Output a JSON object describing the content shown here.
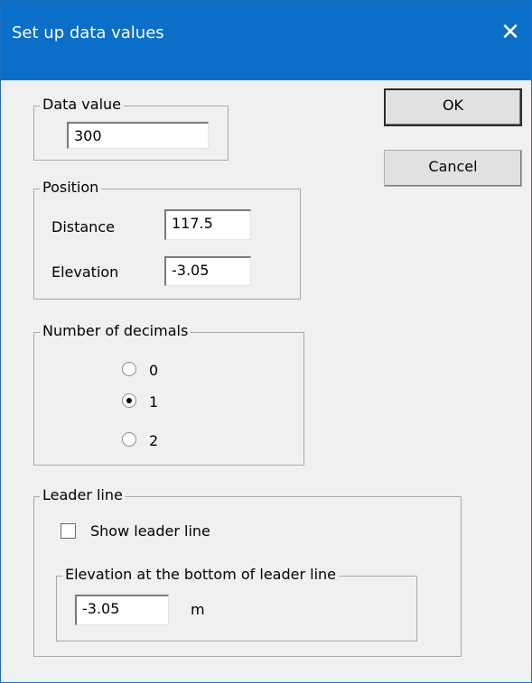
{
  "window": {
    "title": "Set up data values",
    "close_glyph": "✕"
  },
  "data_value": {
    "legend": "Data value",
    "value": "300"
  },
  "buttons": {
    "ok": "OK",
    "cancel": "Cancel"
  },
  "position": {
    "legend": "Position",
    "distance_label": "Distance",
    "distance_value": "117.5",
    "elevation_label": "Elevation",
    "elevation_value": "-3.05"
  },
  "decimals": {
    "legend": "Number of decimals",
    "options": [
      {
        "label": "0",
        "checked": false
      },
      {
        "label": "1",
        "checked": true
      },
      {
        "label": "2",
        "checked": false
      }
    ]
  },
  "leader_line": {
    "legend": "Leader line",
    "show_label": "Show leader line",
    "show_checked": false,
    "bottom": {
      "legend": "Elevation at the bottom of leader line",
      "value": "-3.05",
      "unit": "m"
    }
  },
  "colors": {
    "titlebar": "#0b6fc9",
    "dialog_bg": "#f0f0f0"
  }
}
